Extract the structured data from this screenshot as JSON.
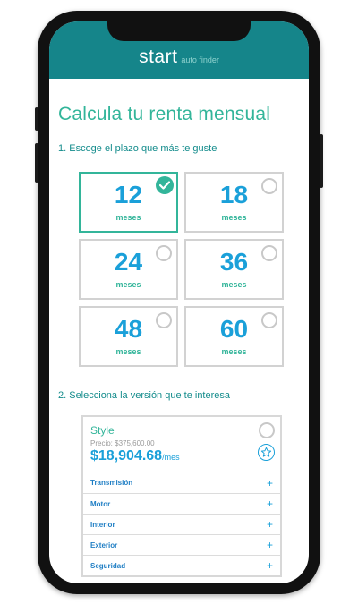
{
  "header": {
    "brand_name": "start",
    "brand_sub": "auto finder"
  },
  "page_title": "Calcula tu renta mensual",
  "step1_label": "1. Escoge el plazo que más te guste",
  "terms": [
    {
      "value": "12",
      "unit": "meses",
      "selected": true
    },
    {
      "value": "18",
      "unit": "meses",
      "selected": false
    },
    {
      "value": "24",
      "unit": "meses",
      "selected": false
    },
    {
      "value": "36",
      "unit": "meses",
      "selected": false
    },
    {
      "value": "48",
      "unit": "meses",
      "selected": false
    },
    {
      "value": "60",
      "unit": "meses",
      "selected": false
    }
  ],
  "step2_label": "2. Selecciona la versión que te interesa",
  "version": {
    "name": "Style",
    "price": "Precio: $375,600.00",
    "monthly": "$18,904.68",
    "per": "/mes",
    "sections": [
      "Transmisión",
      "Motor",
      "Interior",
      "Exterior",
      "Seguridad"
    ],
    "expand_symbol": "+"
  },
  "colors": {
    "header_bg": "#15858a",
    "accent_green": "#33b59a",
    "accent_blue": "#1aa0d9"
  }
}
